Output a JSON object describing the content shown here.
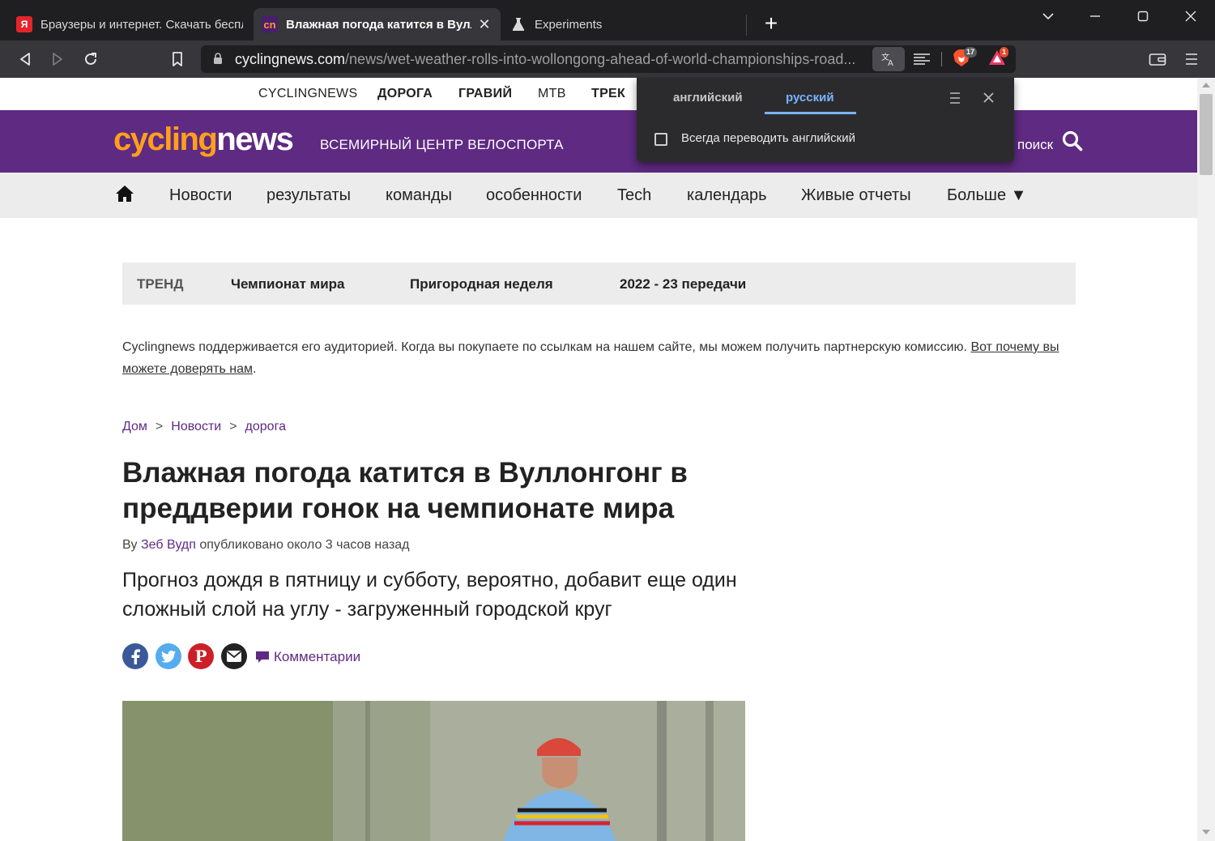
{
  "browser": {
    "tabs": [
      {
        "title": "Браузеры и интернет. Скачать беспл",
        "active": false
      },
      {
        "title": "Влажная погода катится в Вулло",
        "active": true
      },
      {
        "title": "Experiments",
        "active": false
      }
    ],
    "url": {
      "host": "cyclingnews.com",
      "path": "/news/wet-weather-rolls-into-wollongong-ahead-of-world-championships-road..."
    },
    "shields_count": "17",
    "rewards_count": "1"
  },
  "translate_popup": {
    "source_lang": "английский",
    "target_lang": "русский",
    "always_translate_label": "Всегда переводить английский",
    "always_translate_checked": false
  },
  "site": {
    "topnav": [
      "CYCLINGNEWS",
      "ДОРОГА",
      "ГРАВИЙ",
      "МТВ",
      "ТРЕК"
    ],
    "logo": {
      "part1": "cycling",
      "part2": "news"
    },
    "tagline": "ВСЕМИРНЫЙ ЦЕНТР ВЕЛОСПОРТА",
    "search_label": "поиск",
    "mainnav": [
      "Новости",
      "результаты",
      "команды",
      "особенности",
      "Tech",
      "календарь",
      "Живые отчеты",
      "Больше ▼"
    ],
    "trend": {
      "label": "ТРЕНД",
      "items": [
        "Чемпионат мира",
        "Пригородная неделя",
        "2022 - 23 передачи"
      ]
    },
    "disclaimer": {
      "text": "Cyclingnews поддерживается его аудиторией. Когда вы покупаете по ссылкам на нашем сайте, мы можем получить партнерскую комиссию. ",
      "link": "Вот почему вы можете доверять нам",
      "end": "."
    },
    "breadcrumb": [
      "Дом",
      "Новости",
      "дорога"
    ],
    "article": {
      "headline": "Влажная погода катится в Вуллонгонг в преддверии гонок на чемпионате мира",
      "by": "Ву",
      "author": "Зеб Вудп",
      "published": "опубликовано около 3 часов назад",
      "standfirst": "Прогноз дождя в пятницу и субботу, вероятно, добавит еще один сложный слой на углу - загруженный городской круг",
      "comments_label": "Комментарии"
    }
  },
  "colors": {
    "brand_purple": "#5f2a82",
    "brand_orange": "#ff9f1c",
    "chrome_dark": "#1f1f22",
    "chrome_toolbar": "#36363b"
  }
}
